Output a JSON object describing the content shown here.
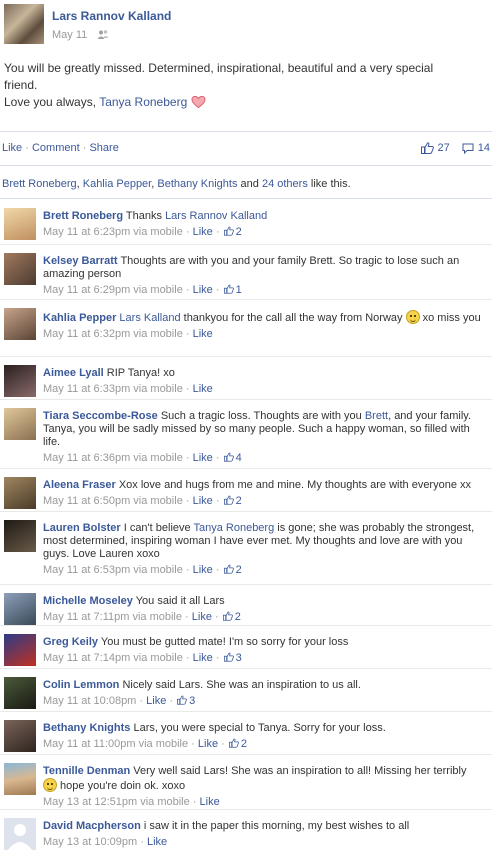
{
  "post": {
    "author": "Lars Rannov Kalland",
    "date": "May 11",
    "text_line1": "You will be greatly missed. Determined, inspirational, beautiful and a very special",
    "text_line2": "friend.",
    "text_line3_prefix": "Love you always,",
    "tagged_name": "Tanya Roneberg"
  },
  "actions": {
    "like": "Like",
    "comment": "Comment",
    "share": "Share",
    "separator": "·",
    "like_count": "27",
    "comment_count": "14"
  },
  "likes": {
    "name1": "Brett Roneberg",
    "name2": "Kahlia Pepper",
    "name3": "Bethany Knights",
    "and": "and",
    "others": "24 others",
    "suffix": "like this."
  },
  "comments": [
    {
      "name": "Brett Roneberg",
      "text": "Thanks",
      "link_after": "Lars Rannov Kalland",
      "text_after": "",
      "time": "May 11 at 6:23pm via mobile",
      "like": "Like",
      "count": "2",
      "avatar_color": "#d9b88a"
    },
    {
      "name": "Kelsey Barratt",
      "text": "Thoughts are with you and your family Brett. So tragic to lose such an amazing person",
      "time": "May 11 at 6:29pm via mobile",
      "like": "Like",
      "count": "1",
      "avatar_color": "#8a6a55"
    },
    {
      "name": "Kahlia Pepper",
      "text": "",
      "link_after": "Lars Kalland",
      "text_after": " thankyou for the call all the way from Norway ",
      "text_end": " xo miss you",
      "time": "May 11 at 6:32pm via mobile",
      "like": "Like",
      "count": "",
      "avatar_color": "#6b5a4f"
    },
    {
      "name": "Aimee Lyall",
      "text": "RIP Tanya! xo",
      "time": "May 11 at 6:33pm via mobile",
      "like": "Like",
      "count": "",
      "avatar_color": "#4a3a3a"
    },
    {
      "name": "Tiara Seccombe-Rose",
      "text": "Such a tragic loss. Thoughts are with you",
      "link_after": "Brett",
      "text_after": ", and your family. Tanya, you will be sadly missed by so many people. Such a happy woman, so filled with life.",
      "time": "May 11 at 6:36pm via mobile",
      "like": "Like",
      "count": "4",
      "avatar_color": "#b8a27c"
    },
    {
      "name": "Aleena Fraser",
      "text": "Xox love and hugs from me and mine. My thoughts are with everyone xx",
      "time": "May 11 at 6:50pm via mobile",
      "like": "Like",
      "count": "2",
      "avatar_color": "#7a6246"
    },
    {
      "name": "Lauren Bolster",
      "text": "I can't believe",
      "link_after": "Tanya Roneberg",
      "text_after": " is gone; she was probably the strongest, most determined, inspiring woman I have ever met. My thoughts and love are with you guys. Love Lauren xoxo",
      "time": "May 11 at 6:53pm via mobile",
      "like": "Like",
      "count": "2",
      "avatar_color": "#3f3a33"
    },
    {
      "name": "Michelle Moseley",
      "text": "You said it all Lars",
      "time": "May 11 at 7:11pm via mobile",
      "like": "Like",
      "count": "2",
      "avatar_color": "#6a7a8c"
    },
    {
      "name": "Greg Keily",
      "text": "You must be gutted mate! I'm so sorry for your loss",
      "time": "May 11 at 7:14pm via mobile",
      "like": "Like",
      "count": "3",
      "avatar_color": "#3d4d8a"
    },
    {
      "name": "Colin Lemmon",
      "text": "Nicely said Lars. She was an inspiration to us all.",
      "time": "May 11 at 10:08pm",
      "like": "Like",
      "count": "3",
      "avatar_color": "#3a3a30"
    },
    {
      "name": "Bethany Knights",
      "text": "Lars, you were special to Tanya. Sorry for your loss.",
      "time": "May 11 at 11:00pm via mobile",
      "like": "Like",
      "count": "2",
      "avatar_color": "#5a4a44"
    },
    {
      "name": "Tennille Denman",
      "text": "Very well said Lars! She was an inspiration to all! Missing her terribly",
      "text_end": " hope you're doin ok. xoxo",
      "time": "May 13 at 12:51pm via mobile",
      "like": "Like",
      "count": "",
      "avatar_color": "#c49a6c"
    },
    {
      "name": "David Macpherson",
      "text": "i saw it in the paper this morning, my best wishes to all",
      "time": "May 13 at 10:09pm",
      "like": "Like",
      "count": "",
      "avatar_color": "#c9d1e0"
    }
  ]
}
